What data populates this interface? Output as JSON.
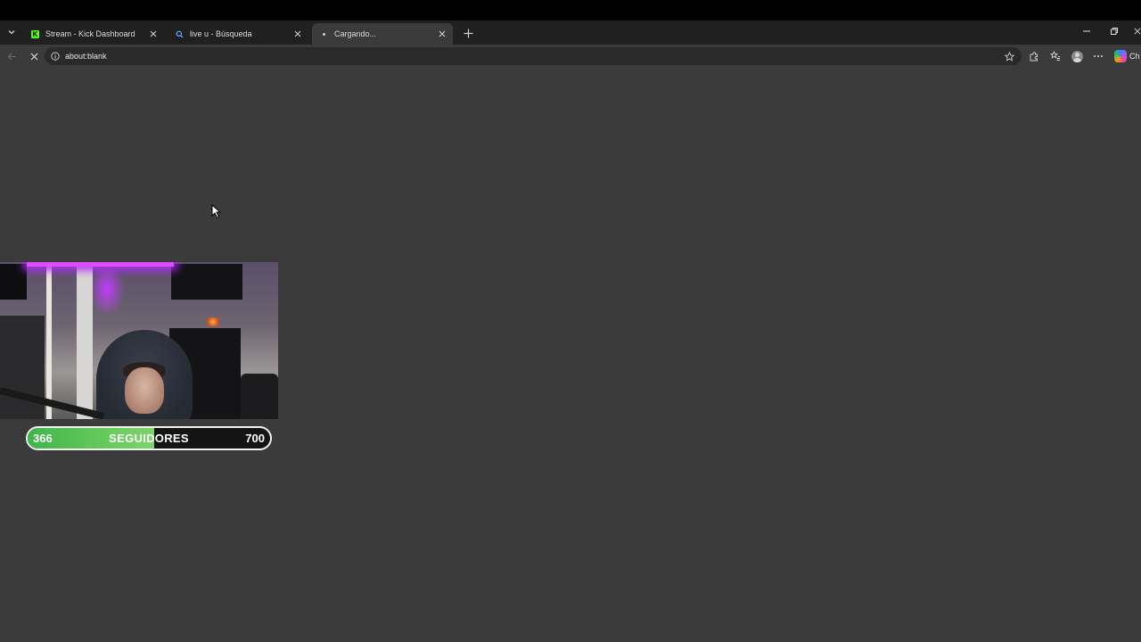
{
  "browser": {
    "tabs": [
      {
        "title": "Stream - Kick Dashboard",
        "favicon": "kick-icon",
        "active": false
      },
      {
        "title": "live u - Búsqueda",
        "favicon": "search-icon",
        "active": false
      },
      {
        "title": "Cargando...",
        "favicon": "loading-dot-icon",
        "active": true
      }
    ],
    "address": "about:blank",
    "sidebar_label": "Ch"
  },
  "follower_goal": {
    "current": "366",
    "label": "SEGUIDORES",
    "target": "700",
    "progress_fraction": 0.523,
    "fill_color": "#5fc65a"
  },
  "colors": {
    "page_background": "#3b3b3b",
    "tabstrip_background": "#202020"
  }
}
